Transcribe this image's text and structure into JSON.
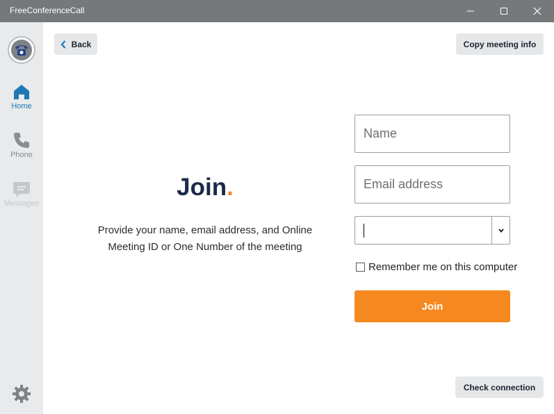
{
  "window": {
    "title": "FreeConferenceCall",
    "minimize_icon": "minimize-icon",
    "maximize_icon": "maximize-icon",
    "close_icon": "close-icon"
  },
  "sidebar": {
    "logo_icon": "phone-logo-icon",
    "items": [
      {
        "label": "Home",
        "icon": "home-icon",
        "state": "active"
      },
      {
        "label": "Phone",
        "icon": "phone-icon",
        "state": "normal"
      },
      {
        "label": "Messages",
        "icon": "chat-bubble-icon",
        "state": "disabled"
      }
    ],
    "settings_icon": "gear-icon"
  },
  "toolbar": {
    "back_label": "Back",
    "copy_label": "Copy meeting info"
  },
  "main": {
    "heading": "Join",
    "heading_dot": ".",
    "description_line1": "Provide your name, email address, and Online",
    "description_line2": "Meeting ID or One Number of the meeting"
  },
  "form": {
    "name_placeholder": "Name",
    "email_placeholder": "Email address",
    "meeting_value": "",
    "remember_label": "Remember me on this computer",
    "remember_checked": false,
    "join_label": "Join"
  },
  "footer": {
    "check_label": "Check connection"
  },
  "colors": {
    "accent": "#f5881f",
    "active_nav": "#1f78b4",
    "heading": "#1b2a4a",
    "titlebar": "#76797b"
  }
}
